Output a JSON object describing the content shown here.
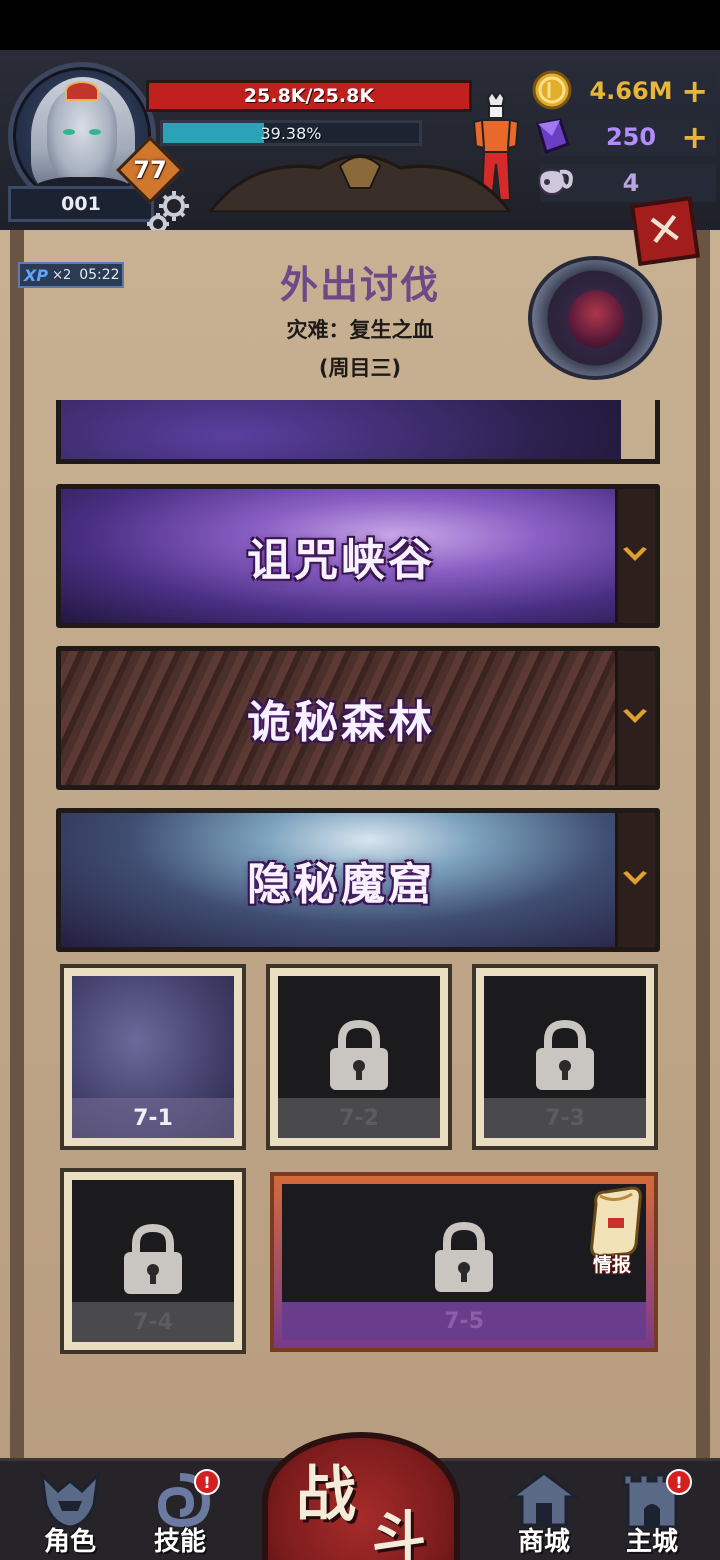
{
  "player": {
    "id": "001",
    "level": "77",
    "hp_text": "25.8K/25.8K",
    "hp_fraction": 1.0,
    "xp_text": "39.38%",
    "xp_fraction": 0.3938
  },
  "resources": {
    "gold": "4.66M",
    "crystal": "250",
    "horn": "4",
    "plus": "+"
  },
  "boost": {
    "tag": "XP",
    "multiplier": "×2",
    "time": "05:22"
  },
  "header": {
    "title": "外出讨伐",
    "subtitle": "灾难：复生之血",
    "cycle": "(周目三)"
  },
  "chapters": [
    {
      "name": "诅咒峡谷"
    },
    {
      "name": "诡秘森林"
    },
    {
      "name": "隐秘魔窟"
    }
  ],
  "stages": [
    {
      "label": "7-1",
      "locked": false
    },
    {
      "label": "7-2",
      "locked": true
    },
    {
      "label": "7-3",
      "locked": true
    },
    {
      "label": "7-4",
      "locked": true
    },
    {
      "label": "7-5",
      "locked": true
    }
  ],
  "intel_label": "情报",
  "nav": {
    "character": "角色",
    "skills": "技能",
    "battle_1": "战",
    "battle_2": "斗",
    "shop": "商城",
    "city": "主城",
    "badge": "!"
  },
  "colors": {
    "hp": "#c0211e",
    "xp": "#2aa3b8",
    "title": "#6b4a86",
    "gold_text": "#e7b53a",
    "crystal_text": "#b38cff",
    "horn_text": "#b9a6e0"
  }
}
